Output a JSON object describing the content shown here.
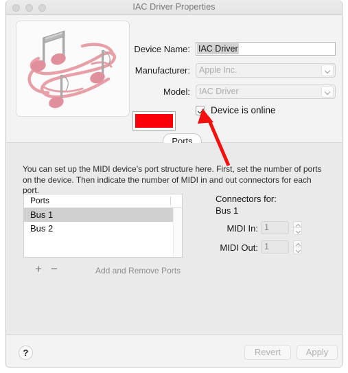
{
  "window": {
    "title": "IAC Driver Properties",
    "traffic_lights": [
      "close",
      "minimize",
      "maximize"
    ]
  },
  "device_form": {
    "device_name_label": "Device Name:",
    "device_name_value": "IAC Driver",
    "manufacturer_label": "Manufacturer:",
    "manufacturer_value": "Apple Inc.",
    "model_label": "Model:",
    "model_value": "IAC Driver",
    "online_checkbox_label": "Device is online",
    "online_checked": true,
    "swatch_color": "#fb0007"
  },
  "tabs": {
    "ports_label": "Ports",
    "active": "Ports"
  },
  "ports_panel": {
    "instructions": "You can set up the MIDI device’s port structure here. First, set the number of ports on the device. Then indicate the number of MIDI in and out connectors for each port.",
    "table_header": "Ports",
    "rows": [
      {
        "label": "Bus 1",
        "selected": true
      },
      {
        "label": "Bus 2",
        "selected": false
      }
    ],
    "add_button_label": "+",
    "remove_button_label": "−",
    "add_remove_label": "Add and Remove Ports"
  },
  "connectors": {
    "title": "Connectors for:",
    "bus": "Bus 1",
    "midi_in_label": "MIDI In:",
    "midi_in_value": "1",
    "midi_out_label": "MIDI Out:",
    "midi_out_value": "1"
  },
  "bottom_bar": {
    "help_label": "?",
    "revert_label": "Revert",
    "apply_label": "Apply"
  },
  "annotation": {
    "arrow_color": "#f5100f",
    "points_to": "Device is online"
  }
}
